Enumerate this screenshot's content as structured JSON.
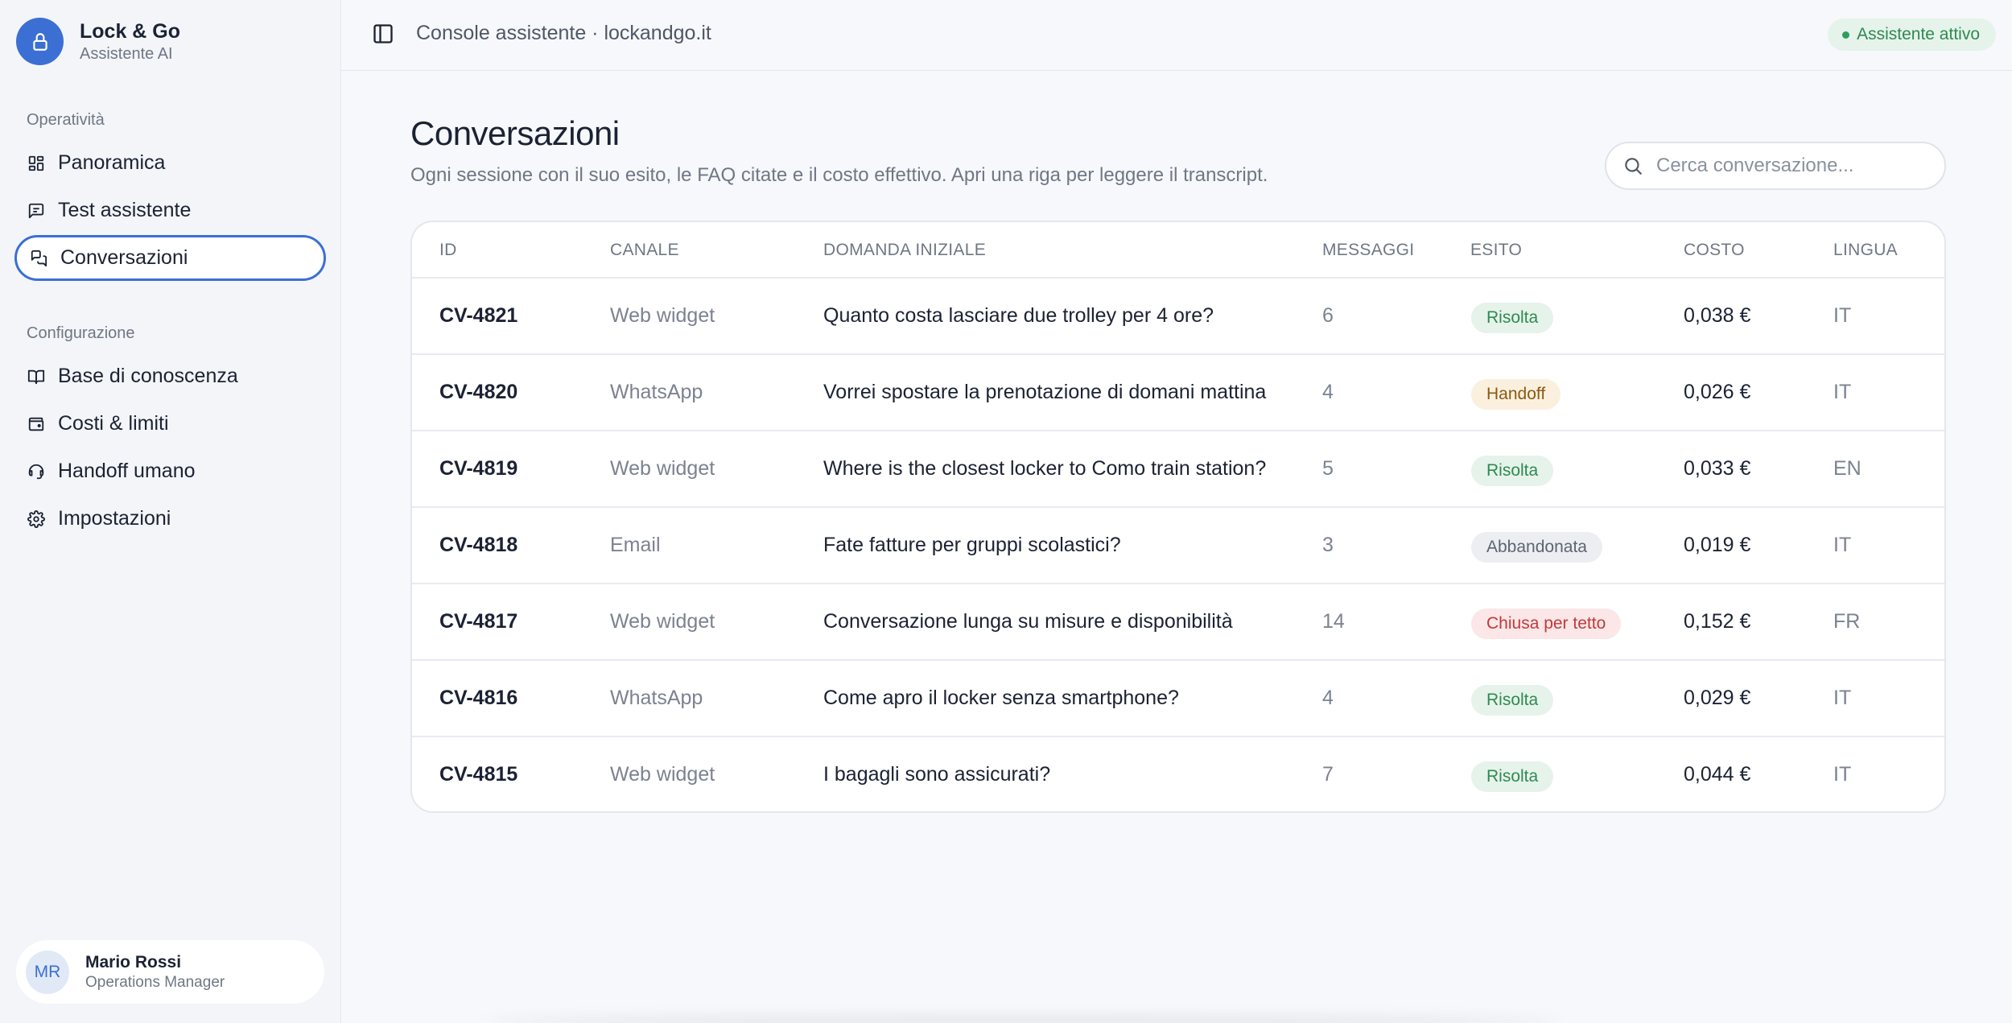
{
  "brand": {
    "name": "Lock & Go",
    "subtitle": "Assistente AI"
  },
  "sidebar": {
    "sections": [
      {
        "label": "Operatività",
        "items": [
          {
            "label": "Panoramica",
            "icon": "grid-icon"
          },
          {
            "label": "Test assistente",
            "icon": "message-square-icon"
          },
          {
            "label": "Conversazioni",
            "icon": "chats-icon",
            "active": true
          }
        ]
      },
      {
        "label": "Configurazione",
        "items": [
          {
            "label": "Base di conoscenza",
            "icon": "book-icon"
          },
          {
            "label": "Costi & limiti",
            "icon": "wallet-icon"
          },
          {
            "label": "Handoff umano",
            "icon": "headset-icon"
          },
          {
            "label": "Impostazioni",
            "icon": "gear-icon"
          }
        ]
      }
    ]
  },
  "user": {
    "initials": "MR",
    "name": "Mario Rossi",
    "role": "Operations Manager"
  },
  "header": {
    "title": "Console assistente · lockandgo.it",
    "status": "Assistente attivo"
  },
  "main": {
    "title": "Conversazioni",
    "subtitle": "Ogni sessione con il suo esito, le FAQ citate e il costo effettivo. Apri una riga per leggere il transcript.",
    "search_placeholder": "Cerca conversazione..."
  },
  "table": {
    "columns": [
      "ID",
      "CANALE",
      "DOMANDA INIZIALE",
      "MESSAGGI",
      "ESITO",
      "COSTO",
      "LINGUA"
    ],
    "rows": [
      {
        "id": "CV-4821",
        "channel": "Web widget",
        "question": "Quanto costa lasciare due trolley per 4 ore?",
        "messages": "6",
        "outcome": "Risolta",
        "outcome_kind": "ok",
        "cost": "0,038 €",
        "lang": "IT"
      },
      {
        "id": "CV-4820",
        "channel": "WhatsApp",
        "question": "Vorrei spostare la prenotazione di domani mattina",
        "messages": "4",
        "outcome": "Handoff",
        "outcome_kind": "hand",
        "cost": "0,026 €",
        "lang": "IT"
      },
      {
        "id": "CV-4819",
        "channel": "Web widget",
        "question": "Where is the closest locker to Como train station?",
        "messages": "5",
        "outcome": "Risolta",
        "outcome_kind": "ok",
        "cost": "0,033 €",
        "lang": "EN"
      },
      {
        "id": "CV-4818",
        "channel": "Email",
        "question": "Fate fatture per gruppi scolastici?",
        "messages": "3",
        "outcome": "Abbandonata",
        "outcome_kind": "aband",
        "cost": "0,019 €",
        "lang": "IT"
      },
      {
        "id": "CV-4817",
        "channel": "Web widget",
        "question": "Conversazione lunga su misure e disponibilità",
        "messages": "14",
        "outcome": "Chiusa per tetto",
        "outcome_kind": "cap",
        "cost": "0,152 €",
        "lang": "FR"
      },
      {
        "id": "CV-4816",
        "channel": "WhatsApp",
        "question": "Come apro il locker senza smartphone?",
        "messages": "4",
        "outcome": "Risolta",
        "outcome_kind": "ok",
        "cost": "0,029 €",
        "lang": "IT"
      },
      {
        "id": "CV-4815",
        "channel": "Web widget",
        "question": "I bagagli sono assicurati?",
        "messages": "7",
        "outcome": "Risolta",
        "outcome_kind": "ok",
        "cost": "0,044 €",
        "lang": "IT"
      }
    ]
  },
  "colors": {
    "accent": "#3b6fd4",
    "success": "#2f8a52",
    "warning": "#8a5a12",
    "danger": "#c23a3a",
    "neutral": "#5d6572"
  }
}
